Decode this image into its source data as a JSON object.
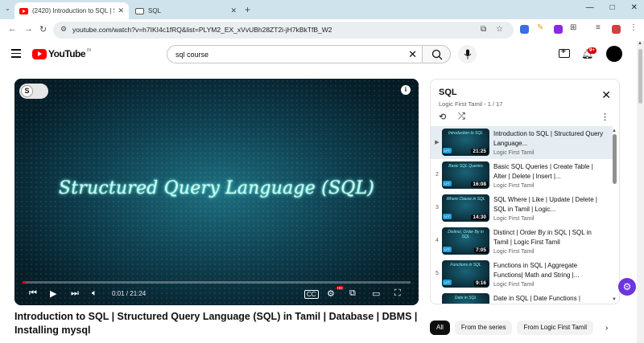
{
  "browser": {
    "tabs": [
      {
        "title": "(2420) Introduction to SQL | St",
        "active": true
      },
      {
        "title": "SQL",
        "active": false
      }
    ],
    "url": "youtube.com/watch?v=h7IKI4c1fRQ&list=PLYM2_EX_xVvUBh28ZT2i-jH7kBkTfB_W2",
    "icons": {
      "back": "←",
      "forward": "→",
      "reload": "↻",
      "tune": "⚙",
      "install": "⧉",
      "star": "☆",
      "new_tab": "+",
      "minimize": "—",
      "maximize": "□",
      "close": "✕"
    }
  },
  "youtube": {
    "logo_text": "YouTube",
    "region": "IN",
    "search_query": "sql course",
    "notifications": "9+"
  },
  "player": {
    "video_title_overlay": "Structured Query Language (SQL)",
    "toggle_letter": "S",
    "info_label": "i",
    "current_time": "0:01",
    "duration": "21:24",
    "time_display": "0:01 / 21:24",
    "progress_fraction": 0.0008,
    "settings_badge": "HD"
  },
  "playlist": {
    "title": "SQL",
    "subtitle": "Logic First Tamil - 1 / 17",
    "items": [
      {
        "index": "▶",
        "title": "Introduction to SQL | Structured Query Language...",
        "channel": "Logic First Tamil",
        "duration": "21:25",
        "thumb_text": "Introduction to SQL",
        "active": true
      },
      {
        "index": "2",
        "title": "Basic SQL Queries | Create Table | Alter | Delete | Insert |...",
        "channel": "Logic First Tamil",
        "duration": "16:08",
        "thumb_text": "Basic SQL Queries"
      },
      {
        "index": "3",
        "title": "SQL Where | Like | Update | Delete | SQL in Tamil | Logic...",
        "channel": "Logic First Tamil",
        "duration": "14:30",
        "thumb_text": "Where Clause in SQL"
      },
      {
        "index": "4",
        "title": "Distinct | Order By in SQL | SQL in Tamil | Logic First Tamil",
        "channel": "Logic First Tamil",
        "duration": "7:05",
        "thumb_text": "Distinct, Order By in SQL"
      },
      {
        "index": "5",
        "title": "Functions in SQL | Aggregate Functions| Math and String |...",
        "channel": "Logic First Tamil",
        "duration": "9:16",
        "thumb_text": "Functions in SQL"
      },
      {
        "index": "6",
        "title": "Date in SQL | Date Functions |",
        "channel": "Logic First Tamil",
        "duration": "",
        "thumb_text": "Date in SQL"
      }
    ]
  },
  "video": {
    "heading": "Introduction to SQL | Structured Query Language (SQL) in Tamil | Database | DBMS | Installing mysql"
  },
  "chips": [
    "All",
    "From the series",
    "From Logic First Tamil"
  ]
}
